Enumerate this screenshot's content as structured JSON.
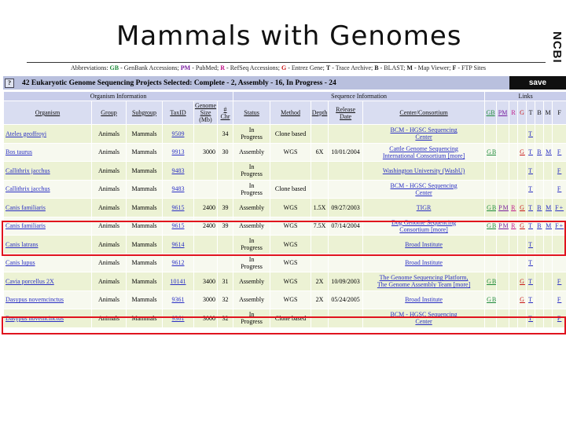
{
  "slide": {
    "title": "Mammals with Genomes",
    "brand": "NCBI"
  },
  "abbreviations": [
    {
      "key": "GB",
      "desc": "GenBank Accessions;",
      "color": "gb"
    },
    {
      "key": "PM",
      "desc": "PubMed;",
      "color": "pm"
    },
    {
      "key": "R",
      "desc": "RefSeq Accessions;",
      "color": "r"
    },
    {
      "key": "G",
      "desc": "Entrez Gene;",
      "color": "g"
    },
    {
      "key": "T",
      "desc": "Trace Archive;",
      "color": ""
    },
    {
      "key": "B",
      "desc": "BLAST;",
      "color": ""
    },
    {
      "key": "M",
      "desc": "Map Viewer;",
      "color": ""
    },
    {
      "key": "F",
      "desc": "FTP Sites",
      "color": ""
    }
  ],
  "abbrev_label": "Abbreviations:",
  "projects_bar": {
    "help": "?",
    "summary": "42 Eukaryotic Genome Sequencing Projects Selected: Complete - 2, Assembly - 16, In Progress - 24",
    "save": "save"
  },
  "table": {
    "groups": {
      "organism": "Organism Information",
      "sequence": "Sequence Information",
      "links": "Links"
    },
    "columns": {
      "organism": "Organism",
      "group": "Group",
      "subgroup": "Subgroup",
      "taxid": "TaxID",
      "genome_size_1": "Genome",
      "genome_size_2": "Size",
      "genome_size_3": "(Mb)",
      "chr_1": "#",
      "chr_2": "Chr",
      "status": "Status",
      "method": "Method",
      "depth": "Depth",
      "release_1": "Release",
      "release_2": "Date",
      "center": "Center/Consortium",
      "gb": "GB",
      "pm": "PM",
      "r": "R",
      "g": "G",
      "t": "T",
      "b": "B",
      "m": "M",
      "f": "F"
    },
    "rows": [
      {
        "organism": "Ateles geoffroyi",
        "group": "Animals",
        "subgroup": "Mammals",
        "taxid": "9509",
        "size": "",
        "chr": "34",
        "status1": "In",
        "status2": "Progress",
        "method": "Clone based",
        "depth": "",
        "date": "",
        "center1": "BCM - HGSC Sequencing",
        "center2": "Center",
        "links": {
          "gb": "",
          "pm": "",
          "r": "",
          "g": "",
          "t": "T",
          "b": "",
          "m": "",
          "f": ""
        }
      },
      {
        "organism": "Bos taurus",
        "group": "Animals",
        "subgroup": "Mammals",
        "taxid": "9913",
        "size": "3000",
        "chr": "30",
        "status1": "Assembly",
        "status2": "",
        "method": "WGS",
        "depth": "6X",
        "date": "10/01/2004",
        "center1": "Cattle Genome Sequencing",
        "center2": "International Consortium [more]",
        "links": {
          "gb": "GB",
          "pm": "",
          "r": "",
          "g": "G",
          "t": "T",
          "b": "B",
          "m": "M",
          "f": "F"
        }
      },
      {
        "organism": "Callithrix jacchus",
        "group": "Animals",
        "subgroup": "Mammals",
        "taxid": "9483",
        "size": "",
        "chr": "",
        "status1": "In",
        "status2": "Progress",
        "method": "",
        "depth": "",
        "date": "",
        "center1": "Washington University (WashU)",
        "center2": "",
        "links": {
          "gb": "",
          "pm": "",
          "r": "",
          "g": "",
          "t": "T",
          "b": "",
          "m": "",
          "f": "F"
        }
      },
      {
        "organism": "Callithrix jacchus",
        "group": "Animals",
        "subgroup": "Mammals",
        "taxid": "9483",
        "size": "",
        "chr": "",
        "status1": "In",
        "status2": "Progress",
        "method": "Clone based",
        "depth": "",
        "date": "",
        "center1": "BCM - HGSC Sequencing",
        "center2": "Center",
        "links": {
          "gb": "",
          "pm": "",
          "r": "",
          "g": "",
          "t": "T",
          "b": "",
          "m": "",
          "f": "F"
        }
      },
      {
        "organism": "Canis familiaris",
        "group": "Animals",
        "subgroup": "Mammals",
        "taxid": "9615",
        "size": "2400",
        "chr": "39",
        "status1": "Assembly",
        "status2": "",
        "method": "WGS",
        "depth": "1.5X",
        "date": "09/27/2003",
        "center1": "TIGR",
        "center2": "",
        "links": {
          "gb": "GB",
          "pm": "PM",
          "r": "R",
          "g": "G",
          "t": "T",
          "b": "B",
          "m": "M",
          "f": "F+"
        }
      },
      {
        "organism": "Canis familiaris",
        "group": "Animals",
        "subgroup": "Mammals",
        "taxid": "9615",
        "size": "2400",
        "chr": "39",
        "status1": "Assembly",
        "status2": "",
        "method": "WGS",
        "depth": "7.5X",
        "date": "07/14/2004",
        "center1": "Dog Genome Sequencing",
        "center2": "Consortium [more]",
        "links": {
          "gb": "GB",
          "pm": "PM",
          "r": "R",
          "g": "G",
          "t": "T",
          "b": "B",
          "m": "M",
          "f": "F+"
        }
      },
      {
        "organism": "Canis latrans",
        "group": "Animals",
        "subgroup": "Mammals",
        "taxid": "9614",
        "size": "",
        "chr": "",
        "status1": "In",
        "status2": "Progress",
        "method": "WGS",
        "depth": "",
        "date": "",
        "center1": "Broad Institute",
        "center2": "",
        "links": {
          "gb": "",
          "pm": "",
          "r": "",
          "g": "",
          "t": "T",
          "b": "",
          "m": "",
          "f": ""
        }
      },
      {
        "organism": "Canis lupus",
        "group": "Animals",
        "subgroup": "Mammals",
        "taxid": "9612",
        "size": "",
        "chr": "",
        "status1": "In",
        "status2": "Progress",
        "method": "WGS",
        "depth": "",
        "date": "",
        "center1": "Broad Institute",
        "center2": "",
        "links": {
          "gb": "",
          "pm": "",
          "r": "",
          "g": "",
          "t": "T",
          "b": "",
          "m": "",
          "f": ""
        }
      },
      {
        "organism": "Cavia porcellus 2X",
        "group": "Animals",
        "subgroup": "Mammals",
        "taxid": "10141",
        "size": "3400",
        "chr": "31",
        "status1": "Assembly",
        "status2": "",
        "method": "WGS",
        "depth": "2X",
        "date": "10/09/2003",
        "center1": "The Genome Sequencing Platform,",
        "center2": "The Genome Assembly Team [more]",
        "links": {
          "gb": "GB",
          "pm": "",
          "r": "",
          "g": "G",
          "t": "T",
          "b": "",
          "m": "",
          "f": "F"
        }
      },
      {
        "organism": "Dasypus novemcinctus",
        "group": "Animals",
        "subgroup": "Mammals",
        "taxid": "9361",
        "size": "3000",
        "chr": "32",
        "status1": "Assembly",
        "status2": "",
        "method": "WGS",
        "depth": "2X",
        "date": "05/24/2005",
        "center1": "Broad Institute",
        "center2": "",
        "links": {
          "gb": "GB",
          "pm": "",
          "r": "",
          "g": "G",
          "t": "T",
          "b": "",
          "m": "",
          "f": "F"
        }
      },
      {
        "organism": "Dasypus novemcinctus",
        "group": "Animals",
        "subgroup": "Mammals",
        "taxid": "9361",
        "size": "3000",
        "chr": "32",
        "status1": "In",
        "status2": "Progress",
        "method": "Clone based",
        "depth": "",
        "date": "",
        "center1": "BCM - HGSC Sequencing",
        "center2": "Center",
        "links": {
          "gb": "",
          "pm": "",
          "r": "",
          "g": "",
          "t": "T",
          "b": "",
          "m": "",
          "f": "F"
        }
      }
    ]
  }
}
